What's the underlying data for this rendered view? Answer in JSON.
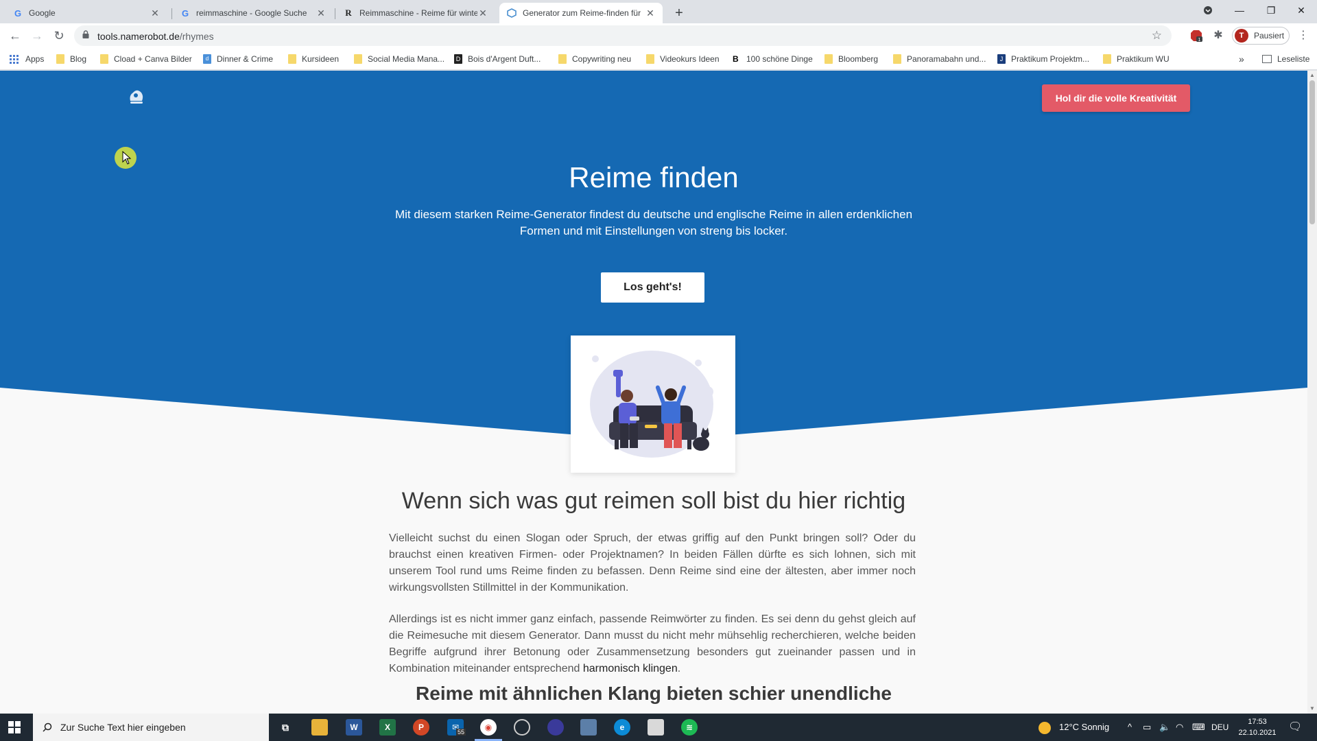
{
  "browser": {
    "tabs": [
      {
        "title": "Google",
        "favicon": "G",
        "active": false
      },
      {
        "title": "reimmaschine - Google Suche",
        "favicon": "G",
        "active": false
      },
      {
        "title": "Reimmaschine - Reime für winter",
        "favicon": "R",
        "active": false
      },
      {
        "title": "Generator zum Reime-finden für",
        "favicon": "namerobot-icon",
        "active": true
      }
    ],
    "new_tab": "+",
    "url_host": "tools.namerobot.de",
    "url_path": "/rhymes",
    "profile_initial": "T",
    "profile_label": "Pausiert",
    "extension_badge": "1",
    "bookmarks": [
      {
        "label": "Apps",
        "icon": "apps-grid-icon"
      },
      {
        "label": "Blog",
        "icon": "folder-icon"
      },
      {
        "label": "Cload + Canva Bilder",
        "icon": "folder-icon"
      },
      {
        "label": "Dinner & Crime",
        "icon": "site-icon"
      },
      {
        "label": "Kursideen",
        "icon": "folder-icon"
      },
      {
        "label": "Social Media Mana...",
        "icon": "folder-icon"
      },
      {
        "label": "Bois d'Argent Duft...",
        "icon": "site-icon"
      },
      {
        "label": "Copywriting neu",
        "icon": "folder-icon"
      },
      {
        "label": "Videokurs Ideen",
        "icon": "folder-icon"
      },
      {
        "label": "100 schöne Dinge",
        "icon": "site-icon"
      },
      {
        "label": "Bloomberg",
        "icon": "folder-icon"
      },
      {
        "label": "Panoramabahn und...",
        "icon": "folder-icon"
      },
      {
        "label": "Praktikum Projektm...",
        "icon": "site-icon"
      },
      {
        "label": "Praktikum WU",
        "icon": "folder-icon"
      }
    ],
    "bookmarks_more": "»",
    "reading_list": "Leseliste"
  },
  "page": {
    "cta_top": "Hol dir die volle Kreativität",
    "hero_title": "Reime finden",
    "hero_text": "Mit diesem starken Reime-Generator findest du deutsche und englische Reime in allen erdenklichen Formen und mit Einstellungen von streng bis locker.",
    "hero_button": "Los geht's!",
    "section_title": "Wenn sich was gut reimen soll bist du hier richtig",
    "para1": "Vielleicht suchst du einen Slogan oder Spruch, der etwas griffig auf den Punkt bringen soll? Oder du brauchst einen kreativen Firmen- oder Projektnamen? In beiden Fällen dürfte es sich lohnen, sich mit unserem Tool rund ums Reime finden zu befassen. Denn Reime sind eine der ältesten, aber immer noch wirkungsvollsten Stillmittel in der Kommunikation.",
    "para2_start": "Allerdings ist es nicht immer ganz einfach, passende Reimwörter zu finden. Es sei denn du gehst gleich auf die Reimesuche mit diesem Generator. Dann musst du nicht mehr mühsehlig recherchieren, welche beiden Begriffe aufgrund ihrer Betonung oder Zusammensetzung besonders gut zueinander passen und in Kombination miteinander entsprechend",
    "para2_link": "harmonisch klingen",
    "para2_end": ".",
    "subsection_title": "Reime mit ähnlichen Klang bieten schier unendliche"
  },
  "taskbar": {
    "search_placeholder": "Zur Suche Text hier eingeben",
    "mail_badge": "55",
    "weather": "12°C  Sonnig",
    "language": "DEU",
    "time": "17:53",
    "date": "22.10.2021"
  },
  "colors": {
    "hero_blue": "#1569b3",
    "cta_red": "#e35a67",
    "page_bg": "#f9f9f9"
  }
}
